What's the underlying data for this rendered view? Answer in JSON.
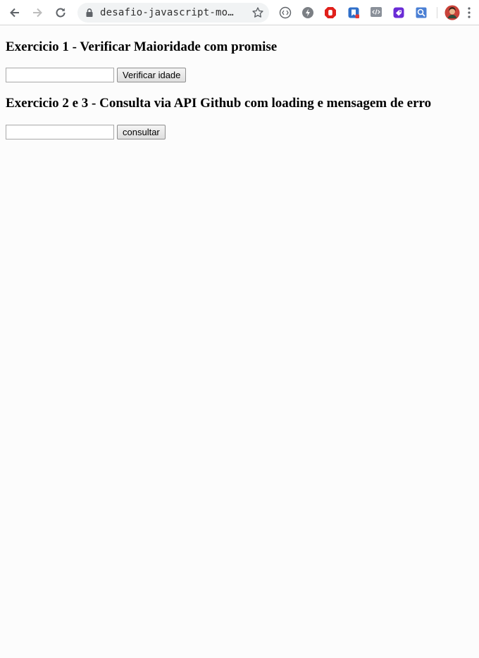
{
  "browser": {
    "url": "desafio-javascript-mo…",
    "extensions": [
      "code-bracket-icon",
      "bolt-icon",
      "stop-hand-icon",
      "bookmark-icon",
      "devtools-icon",
      "tag-icon",
      "search-icon",
      "profile-avatar",
      "kebab-menu-icon"
    ]
  },
  "exercise1": {
    "title": "Exercicio 1 - Verificar Maioridade com promise",
    "input_value": "",
    "button_label": "Verificar idade"
  },
  "exercise2": {
    "title": "Exercicio 2 e 3 - Consulta via API Github com loading e mensagem de erro",
    "input_value": "",
    "button_label": "consultar"
  }
}
